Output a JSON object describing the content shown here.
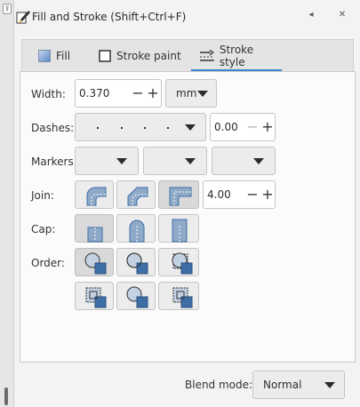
{
  "dialog": {
    "title": "Fill and Stroke (Shift+Ctrl+F)",
    "pin_label": "◂",
    "close_label": "✕",
    "handle_label": "⇪"
  },
  "tabs": [
    {
      "label": "Fill",
      "icon": "fill-icon",
      "active": false
    },
    {
      "label": "Stroke paint",
      "icon": "stroke-paint-icon",
      "active": false
    },
    {
      "label": "Stroke style",
      "icon": "stroke-style-icon",
      "active": true
    }
  ],
  "stroke_style": {
    "width_label": "Width:",
    "width_value": "0.370",
    "unit": "mm",
    "dashes_label": "Dashes:",
    "dash_offset": "0.00",
    "markers_label": "Markers:",
    "join_label": "Join:",
    "join_buttons": [
      "bevel-join-icon",
      "round-join-icon",
      "miter-join-icon"
    ],
    "join_active": "miter",
    "miter_limit": "4.00",
    "cap_label": "Cap:",
    "cap_buttons": [
      "butt-cap-icon",
      "round-cap-icon",
      "square-cap-icon"
    ],
    "cap_active": "butt",
    "order_label": "Order:",
    "minus": "−",
    "plus": "+"
  },
  "blend": {
    "label": "Blend mode:",
    "value": "Normal"
  },
  "colors": {
    "accent": "#3b84d1",
    "icon_fill": "#8fa9c8",
    "icon_dark": "#3d6ea6"
  }
}
